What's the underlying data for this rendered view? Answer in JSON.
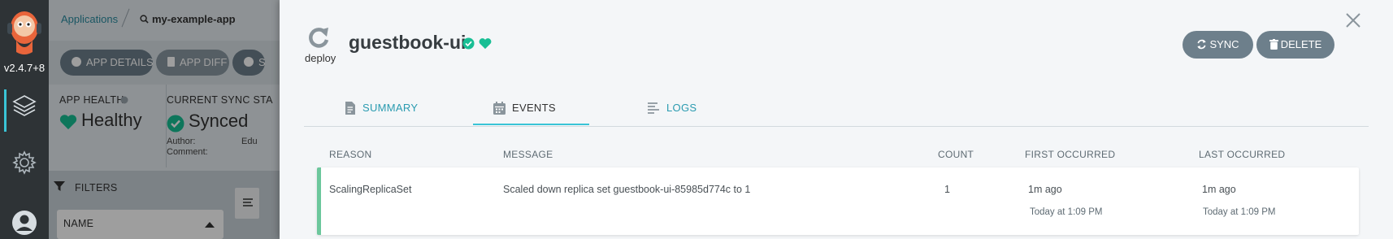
{
  "nav": {
    "version": "v2.4.7+8",
    "icons": [
      "argo-logo-icon",
      "applications-layers-icon",
      "settings-gear-icon",
      "user-avatar-icon"
    ]
  },
  "background": {
    "breadcrumb": {
      "root": "Applications",
      "app": "my-example-app"
    },
    "toolbar": {
      "details": "APP DETAILS",
      "diff": "APP DIFF",
      "sync_partial": "S"
    },
    "health": {
      "label": "APP HEALTH",
      "value": "Healthy"
    },
    "sync": {
      "label": "CURRENT SYNC STA",
      "value": "Synced",
      "author_label": "Author:",
      "comment_label": "Comment:",
      "author_partial": "Edu"
    },
    "filters": {
      "label": "FILTERS",
      "name_label": "NAME"
    }
  },
  "panel": {
    "kind_label": "deploy",
    "title": "guestbook-ui",
    "actions": {
      "sync": "SYNC",
      "delete": "DELETE"
    },
    "tabs": [
      {
        "label": "SUMMARY",
        "icon": "document-icon"
      },
      {
        "label": "EVENTS",
        "icon": "calendar-icon",
        "active": true
      },
      {
        "label": "LOGS",
        "icon": "lines-icon"
      }
    ],
    "events": {
      "columns": {
        "reason": "REASON",
        "message": "MESSAGE",
        "count": "COUNT",
        "first": "FIRST OCCURRED",
        "last": "LAST OCCURRED"
      },
      "rows": [
        {
          "reason": "ScalingReplicaSet",
          "message": "Scaled down replica set guestbook-ui-85985d774c to 1",
          "count": "1",
          "first_relative": "1m ago",
          "first_absolute": "Today at 1:09 PM",
          "last_relative": "1m ago",
          "last_absolute": "Today at 1:09 PM"
        }
      ]
    }
  },
  "colors": {
    "accent": "#3ac4d6",
    "healthy": "#6cc79c",
    "button": "#6d7f8b",
    "nav": "#2e3336",
    "link": "#2a9bb0"
  }
}
